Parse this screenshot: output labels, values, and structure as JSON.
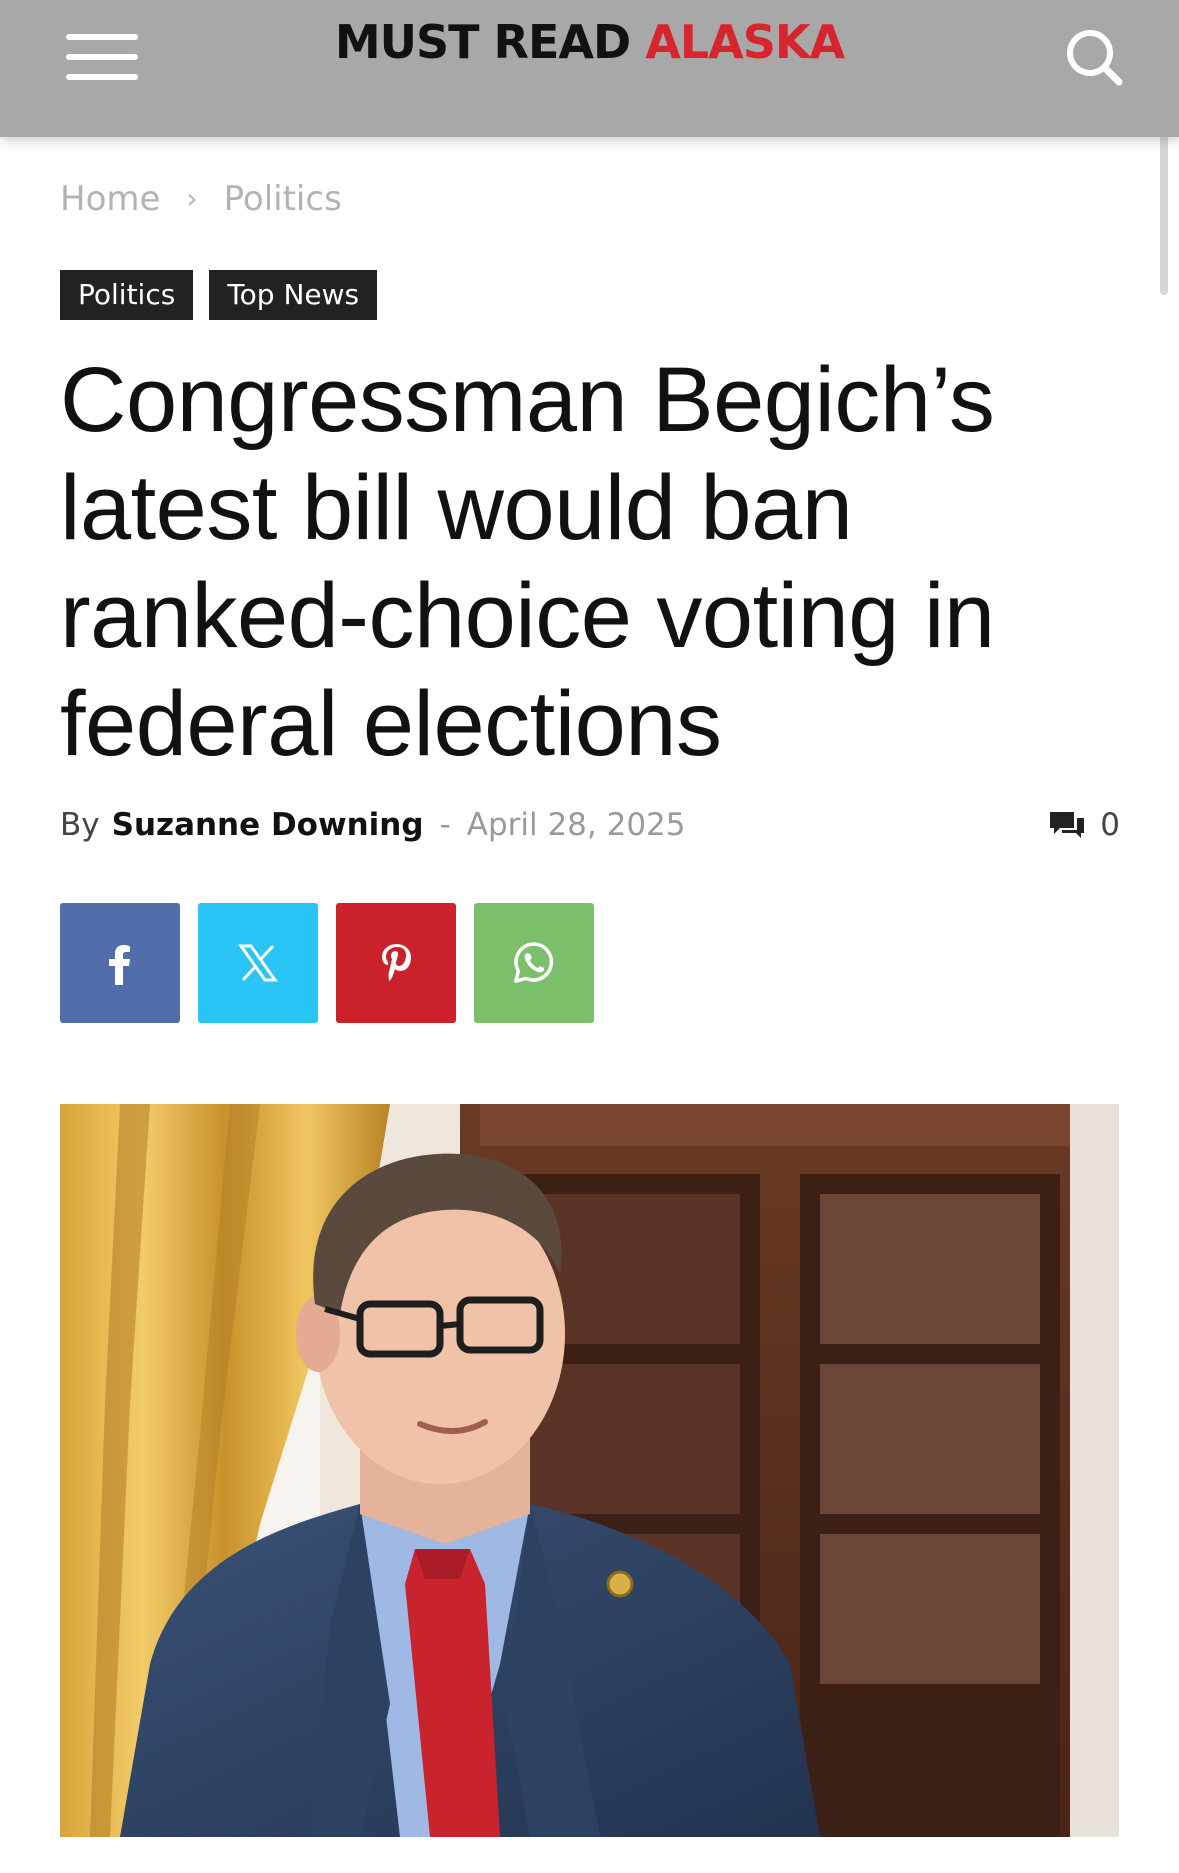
{
  "header": {
    "logo_part1": "MUST READ",
    "logo_part2": "ALASKA",
    "menu_icon": "hamburger-menu-icon",
    "search_icon": "search-icon"
  },
  "breadcrumb": {
    "home": "Home",
    "separator": "›",
    "current": "Politics"
  },
  "tags": [
    "Politics",
    "Top News"
  ],
  "article": {
    "title": "Congressman Begich’s latest bill would ban ranked-choice voting in federal elections",
    "by_label": "By",
    "author": "Suzanne Downing",
    "dash": "-",
    "date": "April 28, 2025",
    "comment_count": "0"
  },
  "share": {
    "buttons": [
      "facebook-icon",
      "x-icon",
      "pinterest-icon",
      "whatsapp-icon"
    ]
  },
  "colors": {
    "header_bg": "#a8a8a8",
    "brand_red": "#d7252f",
    "tag_bg": "#222222",
    "facebook": "#516eab",
    "x": "#29c5f6",
    "pinterest": "#ca212a",
    "whatsapp": "#7bbf6a"
  }
}
